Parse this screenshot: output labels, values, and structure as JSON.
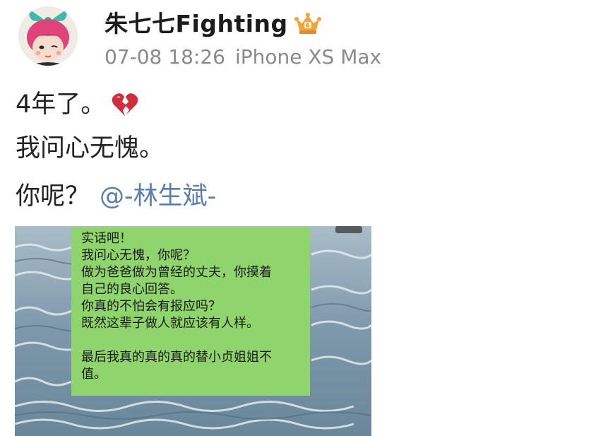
{
  "post": {
    "author": {
      "name": "朱七七Fighting",
      "badge_icon": "crown-badge-icon"
    },
    "meta": {
      "time": "07-08 18:26",
      "device": "iPhone XS Max"
    },
    "lines": {
      "line1": "4年了。",
      "line1_icon": "broken-heart-icon",
      "line2": "我问心无愧。",
      "line3": "你呢？",
      "mention": "@-林生斌-"
    }
  },
  "attached_image": {
    "bubble_lines": [
      "实话吧！",
      "我问心无愧，你呢？",
      "做为爸爸做为曾经的丈夫，你摸着",
      "自己的良心回答。",
      "你真的不怕会有报应吗？",
      "既然这辈子做人就应该有人样。",
      "",
      "最后我真的真的真的替小贞姐姐不",
      "值。"
    ]
  },
  "colors": {
    "mention": "#5b7dab",
    "meta_text": "#8a8a8a",
    "bubble": "#8fd46c",
    "heart": "#d22d3d"
  }
}
